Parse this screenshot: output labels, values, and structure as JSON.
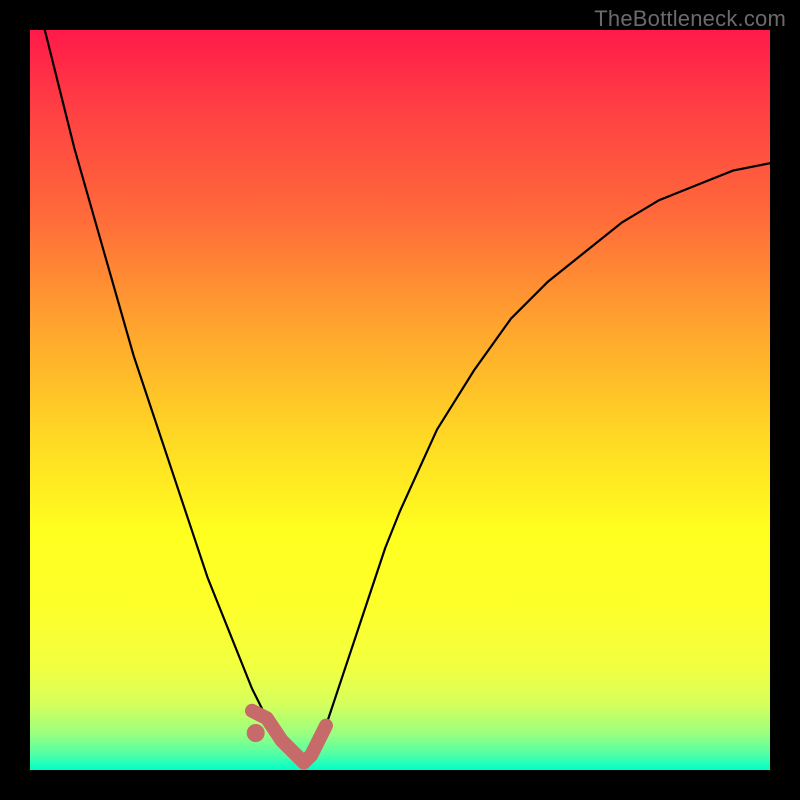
{
  "watermark": "TheBottleneck.com",
  "colors": {
    "background": "#000000",
    "curve": "#000000",
    "valley_marker": "#c76a6a",
    "gradient_top": "#ff1a49",
    "gradient_bottom": "#00ffc9"
  },
  "chart_data": {
    "type": "line",
    "title": "",
    "xlabel": "",
    "ylabel": "",
    "xlim": [
      0,
      100
    ],
    "ylim": [
      0,
      100
    ],
    "x": [
      0,
      2,
      4,
      6,
      8,
      10,
      12,
      14,
      16,
      18,
      20,
      22,
      24,
      26,
      28,
      30,
      32,
      34,
      36,
      37,
      38,
      40,
      42,
      44,
      46,
      48,
      50,
      55,
      60,
      65,
      70,
      75,
      80,
      85,
      90,
      95,
      100
    ],
    "y": [
      108,
      100,
      92,
      84,
      77,
      70,
      63,
      56,
      50,
      44,
      38,
      32,
      26,
      21,
      16,
      11,
      7,
      4,
      2,
      1,
      2,
      6,
      12,
      18,
      24,
      30,
      35,
      46,
      54,
      61,
      66,
      70,
      74,
      77,
      79,
      81,
      82
    ],
    "series": [
      {
        "name": "bottleneck-curve",
        "description": "V-shaped curve; minimum near x≈37, y≈1"
      }
    ],
    "annotations": {
      "valley_highlight_x_range": [
        30,
        40
      ],
      "valley_dot_x": 30.5,
      "valley_dot_y": 5
    }
  }
}
